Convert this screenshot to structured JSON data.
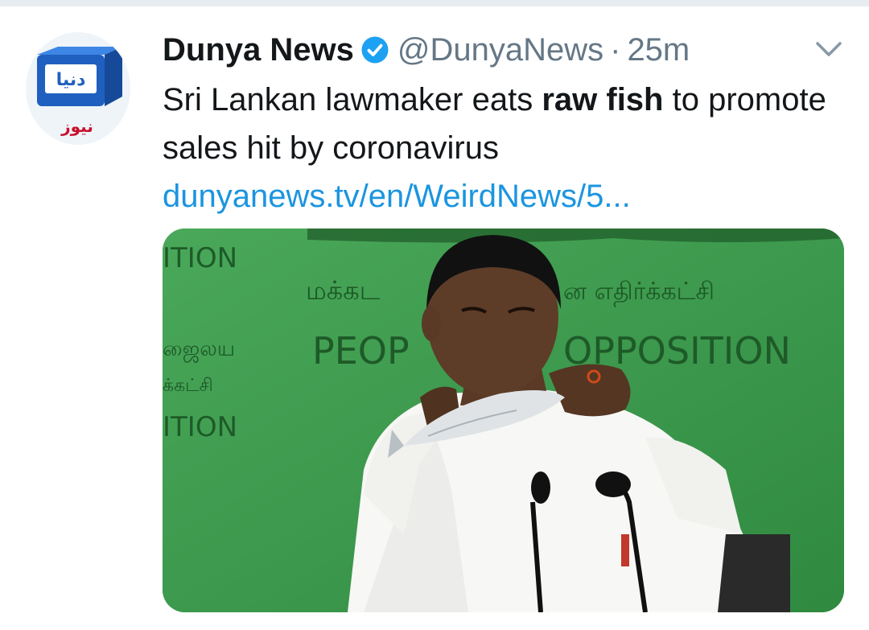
{
  "tweet": {
    "author": {
      "name": "Dunya News",
      "handle": "@DunyaNews",
      "verified": true,
      "avatar_logo_text": "دنیا",
      "avatar_subtext": "نیوز"
    },
    "separator": "·",
    "time": "25m",
    "text_before_bold": "Sri Lankan lawmaker eats ",
    "text_bold": "raw fish",
    "text_after_bold": " to promote sales hit by coronavirus",
    "link": "dunyanews.tv/en/WeirdNews/5...",
    "menu_icon": "chevron-down-icon",
    "media": {
      "backdrop_texts": [
        "ITION",
        "மக்கட",
        "ன எதிர்க்கட்சி",
        "ஜைலய",
        "PEOP",
        "OPPOSITION",
        "க்கட்சி",
        "ITION"
      ]
    }
  },
  "colors": {
    "accent": "#1b95e0",
    "text": "#14171a",
    "secondary": "#657786",
    "verified": "#1da1f2",
    "backdrop": "#3d9a4d"
  }
}
